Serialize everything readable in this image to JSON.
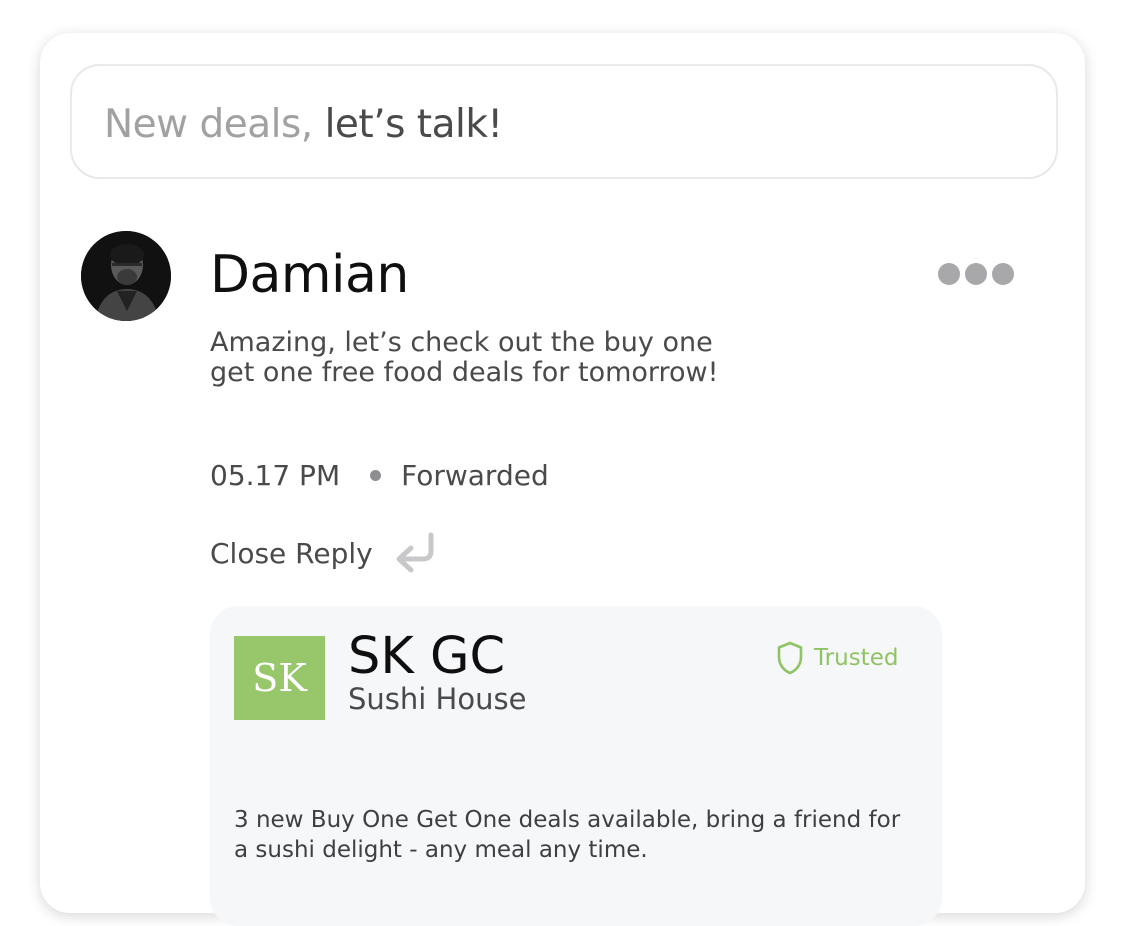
{
  "search": {
    "prefix": "New deals,",
    "emphasis": "let’s talk!"
  },
  "message": {
    "sender": "Damian",
    "avatar_icon": "user-avatar-photo",
    "more_icon": "ellipsis-icon",
    "text": "Amazing, let’s check out the buy one get one free food deals for tomorrow!",
    "time": "05.17 PM",
    "status": "Forwarded",
    "close_reply_label": "Close Reply",
    "reply_icon": "reply-arrow-icon"
  },
  "deal_card": {
    "logo_text": "SK",
    "title": "SK GC",
    "subtitle": "Sushi House",
    "badge": "Trusted",
    "badge_icon": "shield-icon",
    "description": "3 new Buy One Get One deals available, bring a friend for a sushi delight - any meal any time."
  },
  "colors": {
    "accent_green": "#98C76B",
    "trusted_green": "#8FC364",
    "text_dark": "#0F0F10",
    "text_body": "#4A4A4D",
    "muted": "#A1A1A1",
    "card_bg": "#F6F7F9"
  }
}
